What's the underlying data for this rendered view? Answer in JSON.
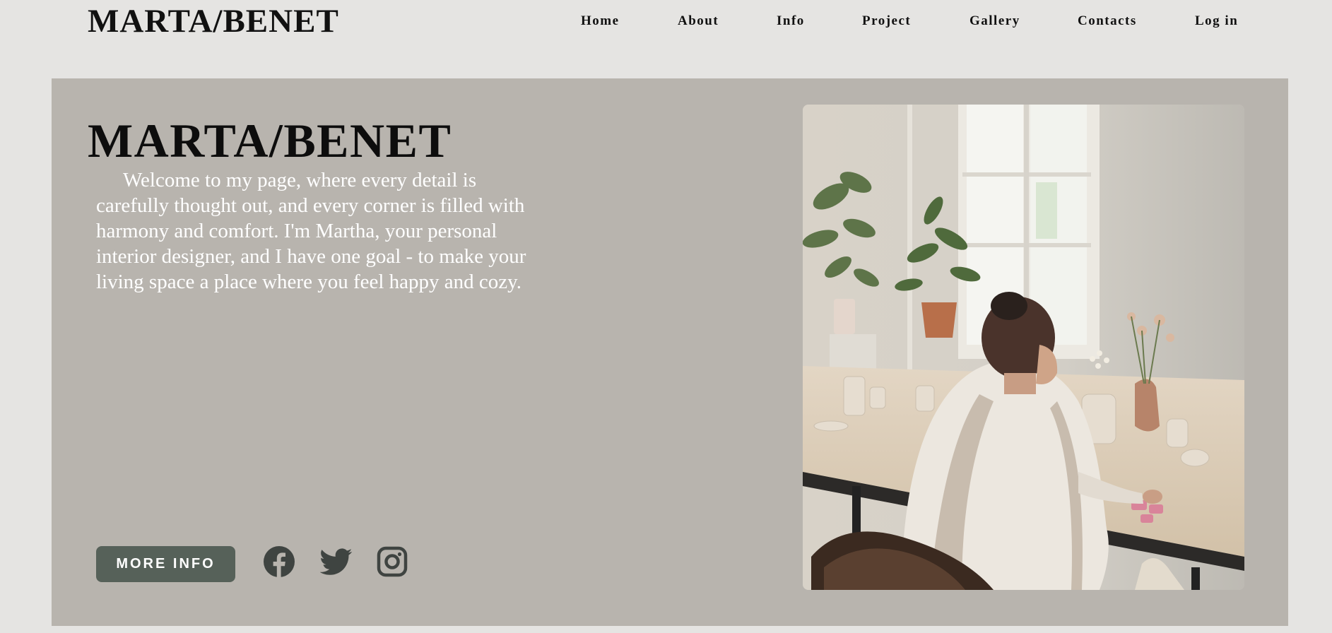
{
  "header": {
    "logo": "MARTA/BENET",
    "nav": [
      {
        "label": "Home"
      },
      {
        "label": "About"
      },
      {
        "label": "Info"
      },
      {
        "label": "Project"
      },
      {
        "label": "Gallery"
      },
      {
        "label": "Contacts"
      },
      {
        "label": "Log in"
      }
    ]
  },
  "hero": {
    "title": "MARTA/BENET",
    "description": "Welcome to my page, where every detail is carefully thought out, and every corner is filled with harmony and comfort. I'm Martha, your personal interior designer, and I have one goal - to make your living space a place where you feel happy and cozy.",
    "cta_label": "MORE INFO",
    "social": [
      {
        "icon": "facebook-icon"
      },
      {
        "icon": "twitter-icon"
      },
      {
        "icon": "instagram-icon"
      }
    ],
    "photo_icon": "studio-photo"
  },
  "colors": {
    "page_bg": "#e5e4e2",
    "hero_bg": "#b8b4ae",
    "button_bg": "#566159",
    "icon_color": "#3f4441",
    "text_dark": "#111111",
    "text_light": "#ffffff"
  }
}
